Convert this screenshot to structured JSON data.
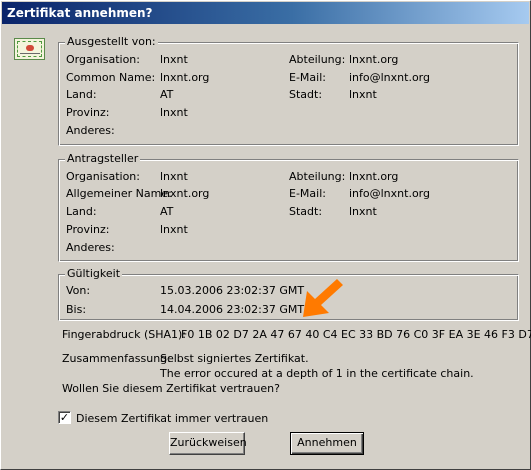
{
  "dialog": {
    "title": "Zertifikat annehmen?"
  },
  "issued_by": {
    "legend": "Ausgestellt von:",
    "organisation_label": "Organisation:",
    "organisation_value": "lnxnt",
    "common_name_label": "Common Name:",
    "common_name_value": "lnxnt.org",
    "land_label": "Land:",
    "land_value": "AT",
    "provinz_label": "Provinz:",
    "provinz_value": "lnxnt",
    "anderes_label": "Anderes:",
    "abteilung_label": "Abteilung:",
    "abteilung_value": "lnxnt.org",
    "email_label": "E-Mail:",
    "email_value": "info@lnxnt.org",
    "stadt_label": "Stadt:",
    "stadt_value": "lnxnt"
  },
  "requester": {
    "legend": "Antragsteller",
    "organisation_label": "Organisation:",
    "organisation_value": "lnxnt",
    "name_label": "Allgemeiner Name:",
    "name_value": "lnxnt.org",
    "land_label": "Land:",
    "land_value": "AT",
    "provinz_label": "Provinz:",
    "provinz_value": "lnxnt",
    "anderes_label": "Anderes:",
    "abteilung_label": "Abteilung:",
    "abteilung_value": "lnxnt.org",
    "email_label": "E-Mail:",
    "email_value": "info@lnxnt.org",
    "stadt_label": "Stadt:",
    "stadt_value": "lnxnt"
  },
  "validity": {
    "legend": "Gültigkeit",
    "from_label": "Von:",
    "from_value": "15.03.2006 23:02:37 GMT",
    "to_label": "Bis:",
    "to_value": "14.04.2006 23:02:37 GMT"
  },
  "fingerprint": {
    "label": "Fingerabdruck (SHA1):",
    "value": "F0 1B 02 D7 2A 47 67 40 C4 EC 33 BD 76 C0 3F EA 3E 46 F3 D7"
  },
  "summary": {
    "label": "Zusammenfassung:",
    "line1": "Selbst signiertes Zertifikat.",
    "line2": "The error occured at a depth of 1 in the certificate chain."
  },
  "question": "Wollen Sie diesem Zertifikat vertrauen?",
  "always_trust": {
    "label": "Diesem Zertifikat immer vertrauen",
    "checked_glyph": "✓"
  },
  "buttons": {
    "reject": "Zurückweisen",
    "accept": "Annehmen"
  },
  "annotation": {
    "arrow_color": "#ff7a00"
  },
  "icons": {
    "certificate": "certificate-icon",
    "arrow": "arrow-down-left-icon"
  }
}
